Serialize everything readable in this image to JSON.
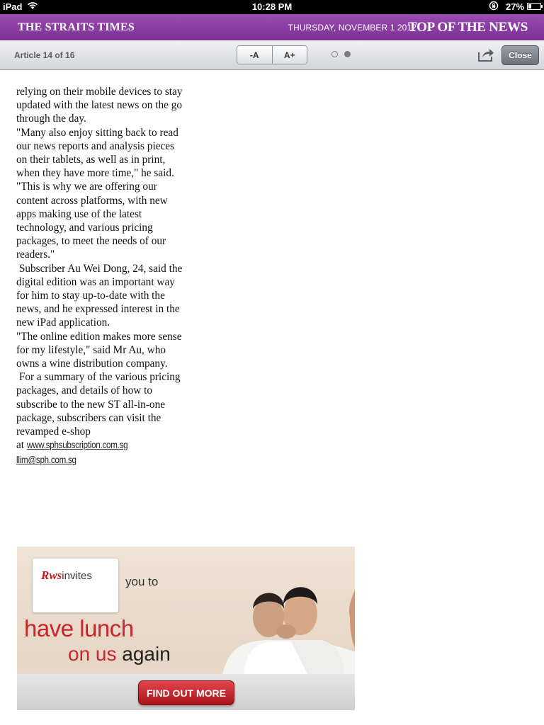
{
  "status_bar": {
    "device": "iPad",
    "time": "10:28 PM",
    "battery_percent_label": "27%",
    "battery_level": 0.27
  },
  "masthead": {
    "brand": "THE STRAITS TIMES",
    "date": "THURSDAY, NOVEMBER 1 2012",
    "section": "TOP OF THE NEWS",
    "color": "#8a3aa2"
  },
  "toolbar": {
    "article_count": "Article 14 of 16",
    "font_decrease_label": "-A",
    "font_increase_label": "A+",
    "close_label": "Close",
    "page_indicator": {
      "total_pages": 2,
      "current_page": 2
    }
  },
  "article": {
    "paragraphs": [
      "relying on their mobile devices to stay updated with the latest news on the go through the day.",
      "\"Many also enjoy sitting back to read our news reports and analysis pieces on their tablets, as well as in print, when they have more time,\" he said.",
      "\"This is why we are offering our content across platforms, with new apps making use of the latest technology, and various pricing packages, to meet the needs of our readers.\"",
      " Subscriber Au Wei Dong, 24, said the digital edition was an important way for him to stay up-to-date with the news, and he expressed interest in the new iPad application.",
      "\"The online edition makes more sense for my lifestyle,\" said Mr Au, who owns a wine distribution company.",
      " For a summary of the various pricing packages, and details of how to subscribe to the new ST all-in-one package, subscribers can visit the revamped e-shop"
    ],
    "link_prefix": "at ",
    "link": "www.sphsubscription.com.sg",
    "email": "llim@sph.com.sg"
  },
  "ad": {
    "logo_brand": "Rws",
    "logo_word": "invites",
    "you_to": "you to",
    "headline": "have lunch",
    "on_us": "on us",
    "again": "again",
    "cta_label": "FIND OUT MORE",
    "accent_color": "#c8262c"
  }
}
